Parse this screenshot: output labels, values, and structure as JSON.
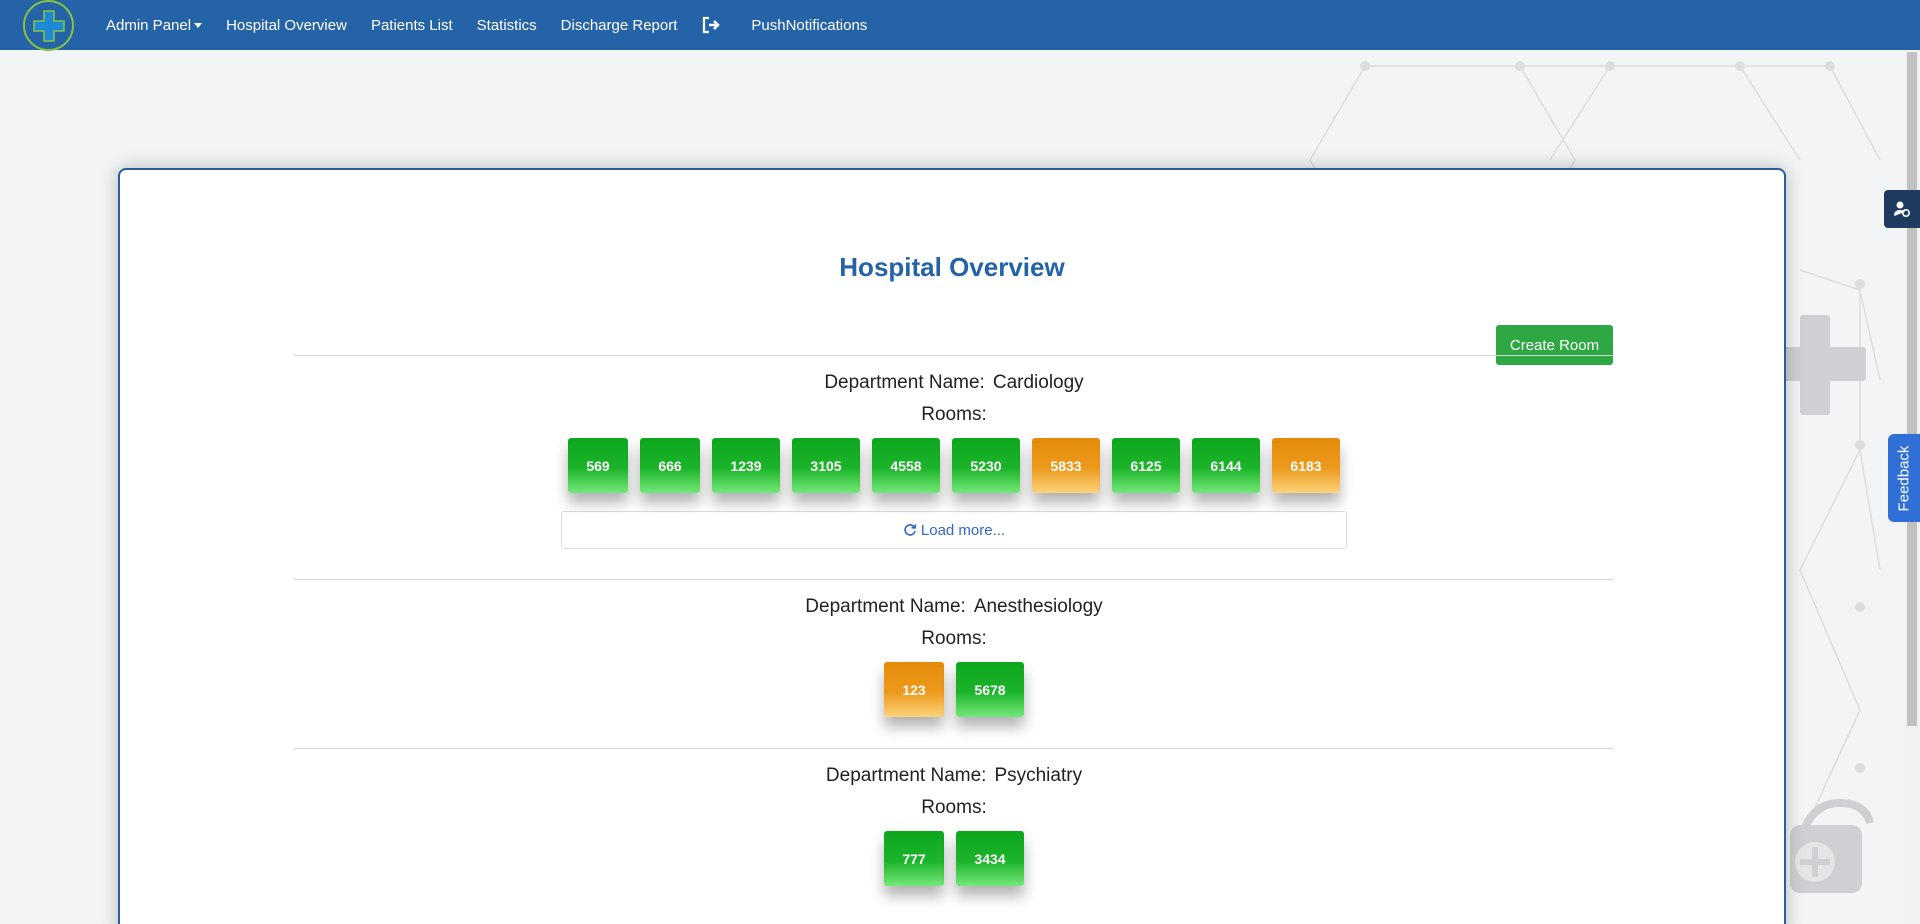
{
  "navbar": {
    "items": [
      {
        "label": "Admin Panel",
        "dropdown": true
      },
      {
        "label": "Hospital Overview"
      },
      {
        "label": "Patients List"
      },
      {
        "label": "Statistics"
      },
      {
        "label": "Discharge Report"
      }
    ],
    "logout_icon": "logout-icon",
    "extra": "PushNotifications"
  },
  "page": {
    "title": "Hospital Overview",
    "create_room_label": "Create Room",
    "dept_prefix": "Department Name:",
    "rooms_label": "Rooms:",
    "load_more_label": "Load more..."
  },
  "departments": [
    {
      "name": "Cardiology",
      "rooms": [
        {
          "number": "569",
          "status": "green"
        },
        {
          "number": "666",
          "status": "green"
        },
        {
          "number": "1239",
          "status": "green"
        },
        {
          "number": "3105",
          "status": "green"
        },
        {
          "number": "4558",
          "status": "green"
        },
        {
          "number": "5230",
          "status": "green"
        },
        {
          "number": "5833",
          "status": "orange"
        },
        {
          "number": "6125",
          "status": "green"
        },
        {
          "number": "6144",
          "status": "green"
        },
        {
          "number": "6183",
          "status": "orange"
        }
      ],
      "has_load_more": true
    },
    {
      "name": "Anesthesiology",
      "rooms": [
        {
          "number": "123",
          "status": "orange"
        },
        {
          "number": "5678",
          "status": "green"
        }
      ],
      "has_load_more": false
    },
    {
      "name": "Psychiatry",
      "rooms": [
        {
          "number": "777",
          "status": "green"
        },
        {
          "number": "3434",
          "status": "green"
        }
      ],
      "has_load_more": false
    }
  ],
  "feedback_label": "Feedback",
  "colors": {
    "navbar": "#2563a8",
    "title": "#2563a8",
    "create_room": "#2ea843",
    "room_green": "#1cb42a",
    "room_orange": "#ec9a1c",
    "feedback": "#2f6fd6"
  }
}
